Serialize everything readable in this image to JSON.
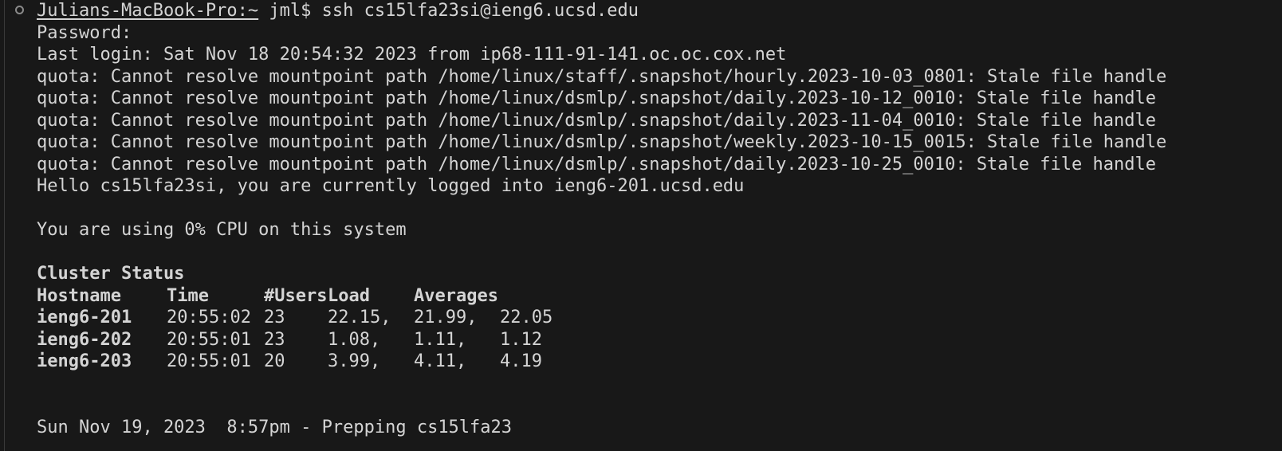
{
  "prompt": {
    "host": "Julians-MacBook-Pro:~",
    "user": " jml$ ",
    "command": "ssh cs15lfa23si@ieng6.ucsd.edu"
  },
  "lines": [
    "Password:",
    "Last login: Sat Nov 18 20:54:32 2023 from ip68-111-91-141.oc.oc.cox.net",
    "quota: Cannot resolve mountpoint path /home/linux/staff/.snapshot/hourly.2023-10-03_0801: Stale file handle",
    "quota: Cannot resolve mountpoint path /home/linux/dsmlp/.snapshot/daily.2023-10-12_0010: Stale file handle",
    "quota: Cannot resolve mountpoint path /home/linux/dsmlp/.snapshot/daily.2023-11-04_0010: Stale file handle",
    "quota: Cannot resolve mountpoint path /home/linux/dsmlp/.snapshot/weekly.2023-10-15_0015: Stale file handle",
    "quota: Cannot resolve mountpoint path /home/linux/dsmlp/.snapshot/daily.2023-10-25_0010: Stale file handle",
    "Hello cs15lfa23si, you are currently logged into ieng6-201.ucsd.edu"
  ],
  "cpu_line": "You are using 0% CPU on this system",
  "cluster": {
    "title": "Cluster Status",
    "headers": [
      "Hostname",
      "Time",
      "#Users",
      "Load",
      "Averages"
    ],
    "rows": [
      {
        "host": "ieng6-201",
        "time": "20:55:02",
        "users": "23",
        "load": "22.15,",
        "avg1": "21.99,",
        "avg2": "22.05"
      },
      {
        "host": "ieng6-202",
        "time": "20:55:01",
        "users": "23",
        "load": "1.08,",
        "avg1": "1.11,",
        "avg2": "1.12"
      },
      {
        "host": "ieng6-203",
        "time": "20:55:01",
        "users": "20",
        "load": "3.99,",
        "avg1": "4.11,",
        "avg2": "4.19"
      }
    ]
  },
  "footer_line": "Sun Nov 19, 2023  8:57pm - Prepping cs15lfa23",
  "colors": {
    "background": "#181818",
    "foreground": "#d4d4d4"
  }
}
